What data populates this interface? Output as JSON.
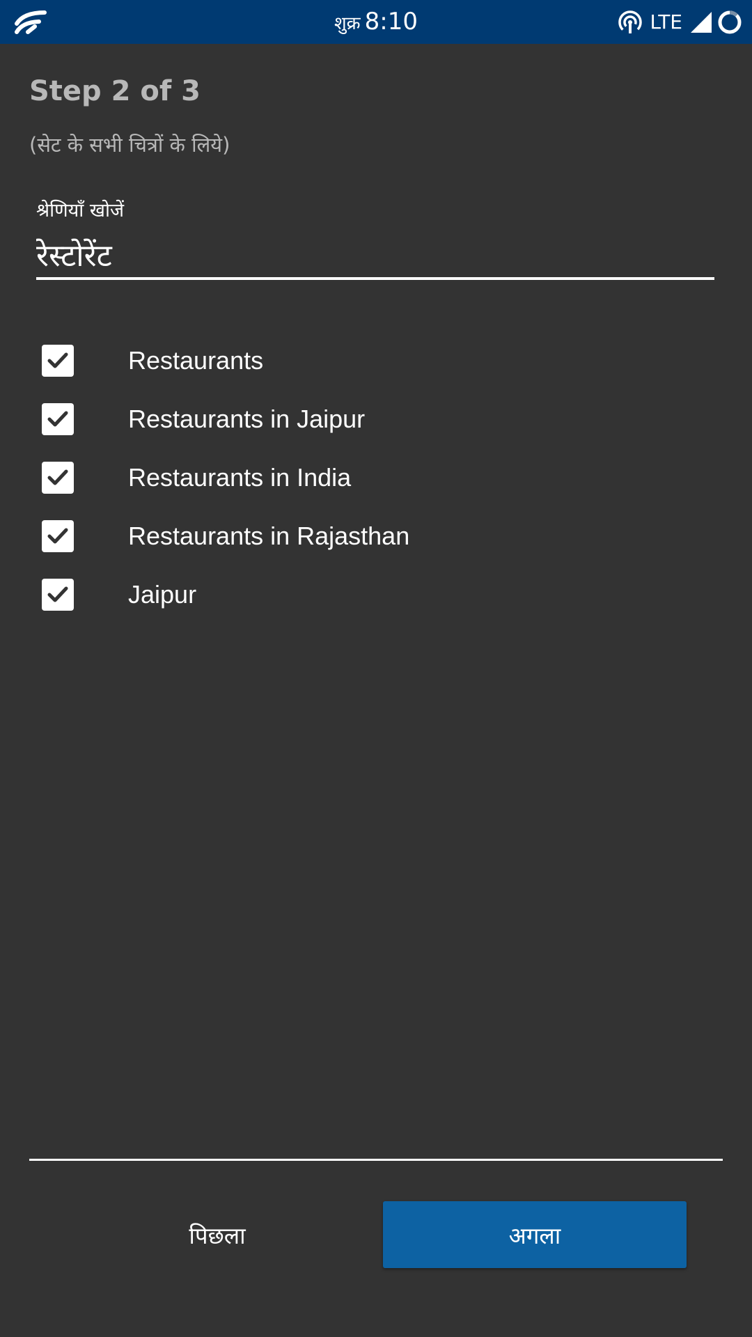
{
  "status_bar": {
    "day": "शुक्र",
    "time": "8:10",
    "network": "LTE",
    "icons": [
      "app-logo-icon",
      "hotspot-icon",
      "signal-icon",
      "sync-icon"
    ]
  },
  "header": {
    "step": "Step 2 of 3",
    "subtitle": "(सेट के सभी चित्रों के लिये)"
  },
  "search": {
    "label": "श्रेणियाँ खोजें",
    "value": "रेस्टोरेंट"
  },
  "categories": [
    {
      "label": "Restaurants",
      "checked": true
    },
    {
      "label": "Restaurants in Jaipur",
      "checked": true
    },
    {
      "label": "Restaurants in India",
      "checked": true
    },
    {
      "label": "Restaurants in Rajasthan",
      "checked": true
    },
    {
      "label": "Jaipur",
      "checked": true
    }
  ],
  "footer": {
    "prev_label": "पिछला",
    "next_label": "अगला"
  },
  "colors": {
    "background": "#333333",
    "status_bar": "#003a72",
    "primary_button": "#0d62a3",
    "muted_text": "#b8b8b8"
  }
}
